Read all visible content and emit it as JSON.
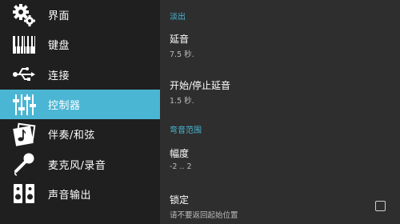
{
  "sidebar": {
    "items": [
      {
        "label": "界面",
        "icon": "gears-icon",
        "active": false
      },
      {
        "label": "键盘",
        "icon": "piano-keys-icon",
        "active": false
      },
      {
        "label": "连接",
        "icon": "usb-icon",
        "active": false
      },
      {
        "label": "控制器",
        "icon": "sliders-icon",
        "active": true
      },
      {
        "label": "伴奏/和弦",
        "icon": "music-note-icon",
        "active": false
      },
      {
        "label": "麦克风/录音",
        "icon": "microphone-icon",
        "active": false
      },
      {
        "label": "声音输出",
        "icon": "speakers-icon",
        "active": false
      }
    ]
  },
  "content": {
    "sections": [
      {
        "header": "淡出",
        "prefs": [
          {
            "title": "延音",
            "summary": "7.5 秒."
          },
          {
            "title": "开始/停止延音",
            "summary": "1.5 秒."
          }
        ]
      },
      {
        "header": "弯音范围",
        "prefs": [
          {
            "title": "幅度",
            "summary": "-2 .. 2"
          },
          {
            "title": "锁定",
            "summary": "请不要返回起始位置",
            "checked": false
          }
        ]
      }
    ]
  },
  "colors": {
    "accent": "#4ab6d4",
    "sidebar_bg": "#1f1f1f",
    "content_bg": "#2e2e2e"
  }
}
